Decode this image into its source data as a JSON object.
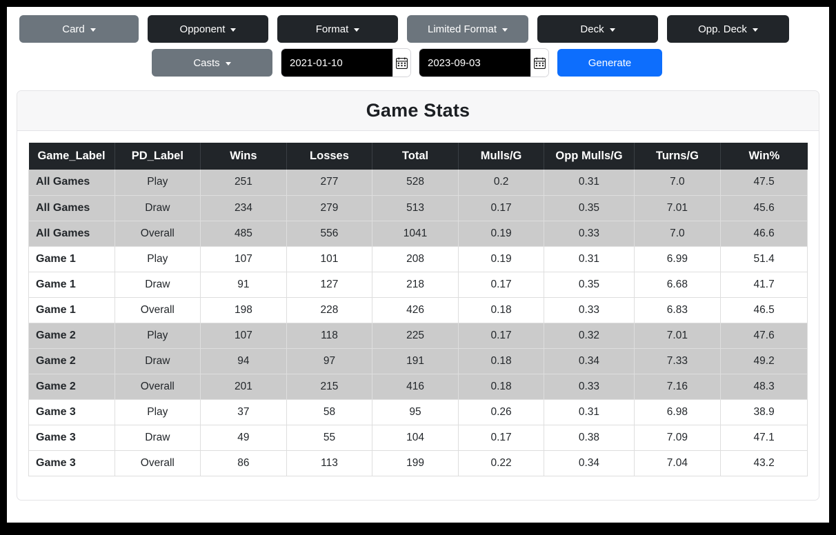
{
  "toolbar": {
    "filters_row1": [
      {
        "id": "card",
        "label": "Card",
        "style": "muted"
      },
      {
        "id": "opponent",
        "label": "Opponent",
        "style": "dark"
      },
      {
        "id": "format",
        "label": "Format",
        "style": "dark"
      },
      {
        "id": "limited",
        "label": "Limited Format",
        "style": "muted"
      },
      {
        "id": "deck",
        "label": "Deck",
        "style": "dark"
      },
      {
        "id": "oppdeck",
        "label": "Opp. Deck",
        "style": "dark"
      }
    ],
    "casts_label": "Casts",
    "start_date": "2021-01-10",
    "end_date": "2023-09-03",
    "date_placeholder": "yyyy-mm-dd",
    "generate_label": "Generate",
    "accent_color": "#0d6efd",
    "dark_color": "#212529",
    "muted_color": "#6c757d"
  },
  "card": {
    "title": "Game Stats"
  },
  "chart_data": {
    "type": "table",
    "title": "Game Stats",
    "columns": [
      "Game_Label",
      "PD_Label",
      "Wins",
      "Losses",
      "Total",
      "Mulls/G",
      "Opp Mulls/G",
      "Turns/G",
      "Win%"
    ],
    "rows": [
      {
        "group": 0,
        "cells": [
          "All Games",
          "Play",
          "251",
          "277",
          "528",
          "0.2",
          "0.31",
          "7.0",
          "47.5"
        ]
      },
      {
        "group": 0,
        "cells": [
          "All Games",
          "Draw",
          "234",
          "279",
          "513",
          "0.17",
          "0.35",
          "7.01",
          "45.6"
        ]
      },
      {
        "group": 0,
        "cells": [
          "All Games",
          "Overall",
          "485",
          "556",
          "1041",
          "0.19",
          "0.33",
          "7.0",
          "46.6"
        ]
      },
      {
        "group": 1,
        "cells": [
          "Game 1",
          "Play",
          "107",
          "101",
          "208",
          "0.19",
          "0.31",
          "6.99",
          "51.4"
        ]
      },
      {
        "group": 1,
        "cells": [
          "Game 1",
          "Draw",
          "91",
          "127",
          "218",
          "0.17",
          "0.35",
          "6.68",
          "41.7"
        ]
      },
      {
        "group": 1,
        "cells": [
          "Game 1",
          "Overall",
          "198",
          "228",
          "426",
          "0.18",
          "0.33",
          "6.83",
          "46.5"
        ]
      },
      {
        "group": 2,
        "cells": [
          "Game 2",
          "Play",
          "107",
          "118",
          "225",
          "0.17",
          "0.32",
          "7.01",
          "47.6"
        ]
      },
      {
        "group": 2,
        "cells": [
          "Game 2",
          "Draw",
          "94",
          "97",
          "191",
          "0.18",
          "0.34",
          "7.33",
          "49.2"
        ]
      },
      {
        "group": 2,
        "cells": [
          "Game 2",
          "Overall",
          "201",
          "215",
          "416",
          "0.18",
          "0.33",
          "7.16",
          "48.3"
        ]
      },
      {
        "group": 3,
        "cells": [
          "Game 3",
          "Play",
          "37",
          "58",
          "95",
          "0.26",
          "0.31",
          "6.98",
          "38.9"
        ]
      },
      {
        "group": 3,
        "cells": [
          "Game 3",
          "Draw",
          "49",
          "55",
          "104",
          "0.17",
          "0.38",
          "7.09",
          "47.1"
        ]
      },
      {
        "group": 3,
        "cells": [
          "Game 3",
          "Overall",
          "86",
          "113",
          "199",
          "0.22",
          "0.34",
          "7.04",
          "43.2"
        ]
      }
    ],
    "striped_groups": [
      0,
      2
    ]
  },
  "icons": {
    "caret": "chevron-down-icon",
    "calendar": "calendar-icon"
  }
}
